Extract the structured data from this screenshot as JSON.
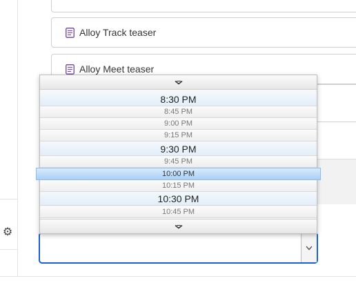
{
  "cards": [
    {
      "label": ""
    },
    {
      "label": "Alloy Track teaser"
    },
    {
      "label": "Alloy Meet teaser"
    }
  ],
  "time_dropdown": {
    "options": [
      {
        "label": "8:30 PM",
        "kind": "major"
      },
      {
        "label": "8:45 PM",
        "kind": "minor"
      },
      {
        "label": "9:00 PM",
        "kind": "minor"
      },
      {
        "label": "9:15 PM",
        "kind": "minor"
      },
      {
        "label": "9:30 PM",
        "kind": "major"
      },
      {
        "label": "9:45 PM",
        "kind": "minor"
      },
      {
        "label": "10:00 PM",
        "kind": "selected"
      },
      {
        "label": "10:15 PM",
        "kind": "minor"
      },
      {
        "label": "10:30 PM",
        "kind": "major"
      },
      {
        "label": "10:45 PM",
        "kind": "minor"
      }
    ],
    "selected_value": "10:00 PM"
  },
  "time_select": {
    "value": ""
  },
  "icons": {
    "settings": "gear-icon",
    "card": "document-icon",
    "scroll_up": "chevron-down-icon",
    "scroll_down": "chevron-down-icon",
    "select_arrow": "chevron-down-icon"
  },
  "colors": {
    "focus_border": "#1a5fd1",
    "selected_option": "#a9d0f6",
    "icon_purple": "#7a4fa0"
  }
}
